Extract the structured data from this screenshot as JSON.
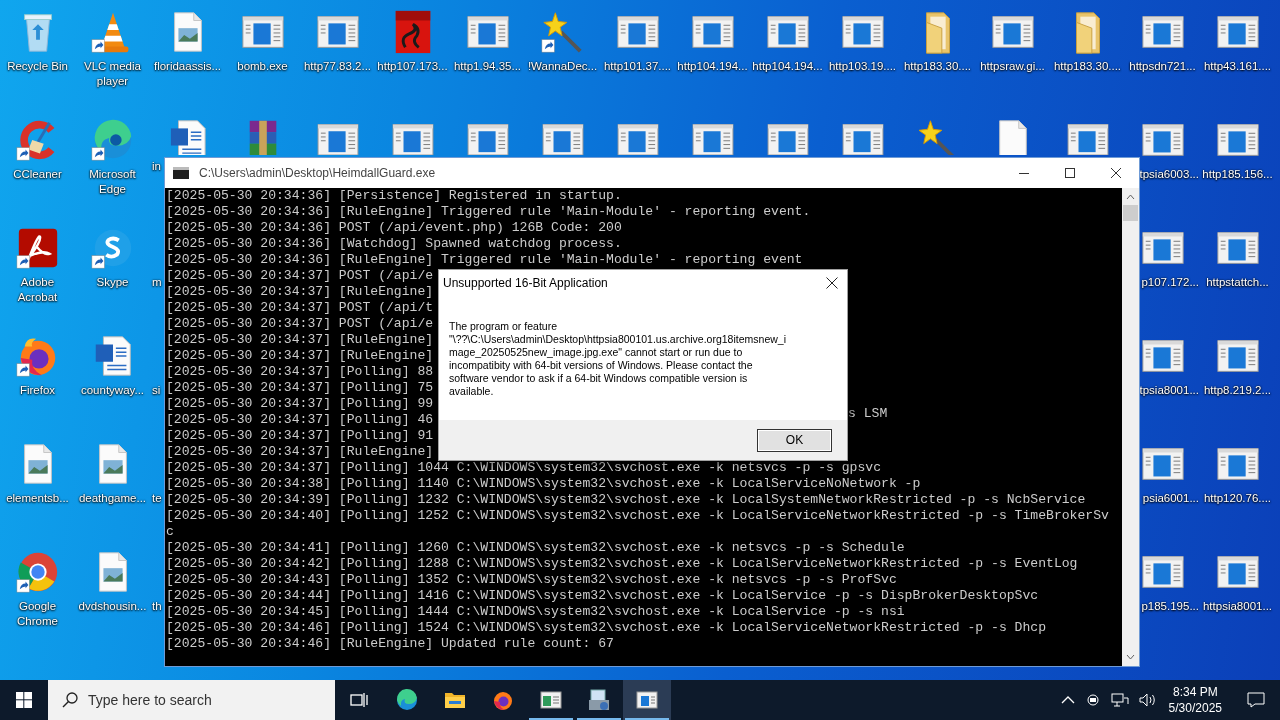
{
  "desktop": {
    "rows": [
      {
        "left": [
          {
            "kind": "recycle",
            "label": "Recycle Bin",
            "shortcut": false
          },
          {
            "kind": "vlc",
            "label": "VLC media player",
            "shortcut": true
          },
          {
            "kind": "image",
            "label": "floridaassis...",
            "shortcut": false
          },
          {
            "kind": "window",
            "label": "bomb.exe",
            "shortcut": false
          },
          {
            "kind": "window",
            "label": "http77.83.2...",
            "shortcut": false
          },
          {
            "kind": "pdf",
            "label": "http107.173...",
            "shortcut": false
          },
          {
            "kind": "window",
            "label": "http1.94.35...",
            "shortcut": false
          },
          {
            "kind": "wand",
            "label": "!WannaDec...",
            "shortcut": true
          },
          {
            "kind": "window",
            "label": "http101.37....",
            "shortcut": false
          },
          {
            "kind": "window",
            "label": "http104.194...",
            "shortcut": false
          },
          {
            "kind": "window",
            "label": "http104.194...",
            "shortcut": false
          },
          {
            "kind": "window",
            "label": "http103.19....",
            "shortcut": false
          },
          {
            "kind": "folder",
            "label": "http183.30....",
            "shortcut": false
          },
          {
            "kind": "window",
            "label": "httpsraw.gi...",
            "shortcut": false
          },
          {
            "kind": "folder",
            "label": "http183.30....",
            "shortcut": false
          },
          {
            "kind": "window",
            "label": "httpsdn721...",
            "shortcut": false
          },
          {
            "kind": "window",
            "label": "http43.161....",
            "shortcut": false
          }
        ],
        "right": []
      },
      {
        "left": [
          {
            "kind": "ccleaner",
            "label": "CCleaner",
            "shortcut": true
          },
          {
            "kind": "edge",
            "label": "Microsoft Edge",
            "shortcut": true
          },
          {
            "kind": "word",
            "label": "in",
            "shortcut": false
          },
          {
            "kind": "winrar",
            "shortcut": false
          },
          {
            "kind": "window",
            "shortcut": false
          },
          {
            "kind": "window",
            "shortcut": false
          },
          {
            "kind": "window",
            "shortcut": false
          },
          {
            "kind": "window",
            "shortcut": false
          },
          {
            "kind": "window",
            "shortcut": false
          },
          {
            "kind": "window",
            "shortcut": false
          },
          {
            "kind": "window",
            "shortcut": false
          },
          {
            "kind": "window",
            "shortcut": false
          },
          {
            "kind": "wand",
            "shortcut": false
          },
          {
            "kind": "blank",
            "shortcut": false
          },
          {
            "kind": "window",
            "shortcut": false
          }
        ],
        "right": [
          {
            "kind": "window",
            "label": "tpsia6003...",
            "shortcut": false
          },
          {
            "kind": "window",
            "label": "http185.156...",
            "shortcut": false
          }
        ]
      },
      {
        "left": [
          {
            "kind": "acrobat",
            "label": "Adobe Acrobat",
            "shortcut": true
          },
          {
            "kind": "skype",
            "label": "Skype",
            "shortcut": true
          },
          {
            "kind": "none",
            "label": "m"
          }
        ],
        "right": [
          {
            "kind": "window",
            "label": "p107.172...",
            "shortcut": false
          },
          {
            "kind": "window",
            "label": "httpstattch...",
            "shortcut": false
          }
        ]
      },
      {
        "left": [
          {
            "kind": "firefox",
            "label": "Firefox",
            "shortcut": true
          },
          {
            "kind": "word",
            "label": "countyway...",
            "shortcut": false
          },
          {
            "kind": "none",
            "label": "si"
          }
        ],
        "right": [
          {
            "kind": "window",
            "label": "tpsia8001...",
            "shortcut": false
          },
          {
            "kind": "window",
            "label": "http8.219.2...",
            "shortcut": false
          }
        ]
      },
      {
        "left": [
          {
            "kind": "image",
            "label": "elementsb...",
            "shortcut": false
          },
          {
            "kind": "image",
            "label": "deathgame...",
            "shortcut": false
          },
          {
            "kind": "none",
            "label": "te"
          }
        ],
        "right": [
          {
            "kind": "window",
            "label": "psia6001...",
            "shortcut": false
          },
          {
            "kind": "window",
            "label": "http120.76....",
            "shortcut": false
          }
        ]
      },
      {
        "left": [
          {
            "kind": "chrome",
            "label": "Google Chrome",
            "shortcut": true
          },
          {
            "kind": "image",
            "label": "dvdshousin...",
            "shortcut": false
          },
          {
            "kind": "none",
            "label": "th"
          }
        ],
        "right": [
          {
            "kind": "window",
            "label": "p185.195...",
            "shortcut": false
          },
          {
            "kind": "window",
            "label": "httpsia8001...",
            "shortcut": false
          }
        ]
      }
    ]
  },
  "console": {
    "title": "C:\\Users\\admin\\Desktop\\HeimdallGuard.exe",
    "lines": [
      {
        "text": "[2025-05-30 20:34:36] [Persistence] Registered in startup."
      },
      {
        "text": "[2025-05-30 20:34:36] [RuleEngine] Triggered rule 'Main-Module' - reporting event."
      },
      {
        "text": "[2025-05-30 20:34:36] POST (/api/event.php) 126B Code: 200"
      },
      {
        "text": "[2025-05-30 20:34:36] [Watchdog] Spawned watchdog process."
      },
      {
        "text": "[2025-05-30 20:34:36] [RuleEngine] Triggered rule 'Main-Module' - reporting event"
      },
      {
        "text": "[2025-05-30 20:34:37] POST (/api/e"
      },
      {
        "text": "[2025-05-30 20:34:37] [RuleEngine]"
      },
      {
        "text": "[2025-05-30 20:34:37] POST (/api/t"
      },
      {
        "text": "[2025-05-30 20:34:37] POST (/api/e"
      },
      {
        "text": "[2025-05-30 20:34:37] [RuleEngine]"
      },
      {
        "text": "[2025-05-30 20:34:37] [RuleEngine]"
      },
      {
        "text": "[2025-05-30 20:34:37] [Polling] 88"
      },
      {
        "text": "[2025-05-30 20:34:37] [Polling] 75"
      },
      {
        "text": "[2025-05-30 20:34:37] [Polling] 99"
      },
      {
        "text": "[2025-05-30 20:34:37] [Polling] 46",
        "tail": "s LSM"
      },
      {
        "text": "[2025-05-30 20:34:37] [Polling] 91"
      },
      {
        "text": "[2025-05-30 20:34:37] [RuleEngine]"
      },
      {
        "text": "[2025-05-30 20:34:37] [Polling] 1044 C:\\WINDOWS\\system32\\svchost.exe -k netsvcs -p -s gpsvc"
      },
      {
        "text": "[2025-05-30 20:34:38] [Polling] 1140 C:\\WINDOWS\\system32\\svchost.exe -k LocalServiceNoNetwork -p"
      },
      {
        "text": "[2025-05-30 20:34:39] [Polling] 1232 C:\\WINDOWS\\system32\\svchost.exe -k LocalSystemNetworkRestricted -p -s NcbService"
      },
      {
        "text": "[2025-05-30 20:34:40] [Polling] 1252 C:\\WINDOWS\\system32\\svchost.exe -k LocalServiceNetworkRestricted -p -s TimeBrokerSv"
      },
      {
        "text": "c"
      },
      {
        "text": "[2025-05-30 20:34:41] [Polling] 1260 C:\\WINDOWS\\system32\\svchost.exe -k netsvcs -p -s Schedule"
      },
      {
        "text": "[2025-05-30 20:34:42] [Polling] 1288 C:\\WINDOWS\\system32\\svchost.exe -k LocalServiceNetworkRestricted -p -s EventLog"
      },
      {
        "text": "[2025-05-30 20:34:43] [Polling] 1352 C:\\WINDOWS\\system32\\svchost.exe -k netsvcs -p -s ProfSvc"
      },
      {
        "text": "[2025-05-30 20:34:44] [Polling] 1416 C:\\WINDOWS\\system32\\svchost.exe -k LocalService -p -s DispBrokerDesktopSvc"
      },
      {
        "text": "[2025-05-30 20:34:45] [Polling] 1444 C:\\WINDOWS\\system32\\svchost.exe -k LocalService -p -s nsi"
      },
      {
        "text": "[2025-05-30 20:34:46] [Polling] 1524 C:\\WINDOWS\\system32\\svchost.exe -k LocalServiceNetworkRestricted -p -s Dhcp"
      },
      {
        "text": "[2025-05-30 20:34:46] [RuleEngine] Updated rule count: 67"
      }
    ]
  },
  "dialog": {
    "title": "Unsupported 16-Bit Application",
    "message": "The program or feature\n\"\\??\\C:\\Users\\admin\\Desktop\\httpsia800101.us.archive.org18itemsnew_i\nmage_20250525new_image.jpg.exe\" cannot start or run due to\nincompatibity with 64-bit versions of Windows. Please contact the\nsoftware vendor to ask if a 64-bit Windows compatible version is\navailable.",
    "button": "OK"
  },
  "taskbar": {
    "search": {
      "placeholder": "Type here to search"
    },
    "apps": [
      {
        "kind": "edge",
        "running": false,
        "selected": false
      },
      {
        "kind": "explorer",
        "running": false,
        "selected": false
      },
      {
        "kind": "firefox",
        "running": false,
        "selected": false
      },
      {
        "kind": "app",
        "running": true,
        "selected": false
      },
      {
        "kind": "installer",
        "running": true,
        "selected": false
      },
      {
        "kind": "console",
        "running": true,
        "selected": true
      }
    ],
    "time": "8:34 PM",
    "date": "5/30/2025"
  }
}
